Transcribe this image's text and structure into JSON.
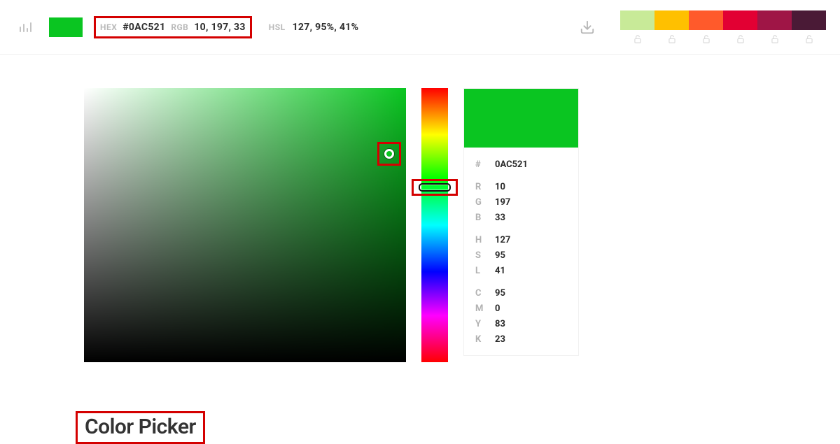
{
  "topbar": {
    "hex_label": "HEX",
    "hex_value": "#0AC521",
    "rgb_label": "RGB",
    "rgb_value": "10, 197, 33",
    "hsl_label": "HSL",
    "hsl_value": "127, 95%, 41%",
    "current_color": "#0AC521"
  },
  "palette": [
    "#c8ea98",
    "#ffc000",
    "#ff5a2b",
    "#e20033",
    "#9f1546",
    "#4a1a36"
  ],
  "info": {
    "hash": "#",
    "hex": "0AC521",
    "R_k": "R",
    "R_v": "10",
    "G_k": "G",
    "G_v": "197",
    "B_k": "B",
    "B_v": "33",
    "H_k": "H",
    "H_v": "127",
    "S_k": "S",
    "S_v": "95",
    "L_k": "L",
    "L_v": "41",
    "C_k": "C",
    "C_v": "95",
    "M_k": "M",
    "M_v": "0",
    "Y_k": "Y",
    "Y_v": "83",
    "K_k": "K",
    "K_v": "23"
  },
  "heading": "Color Picker"
}
